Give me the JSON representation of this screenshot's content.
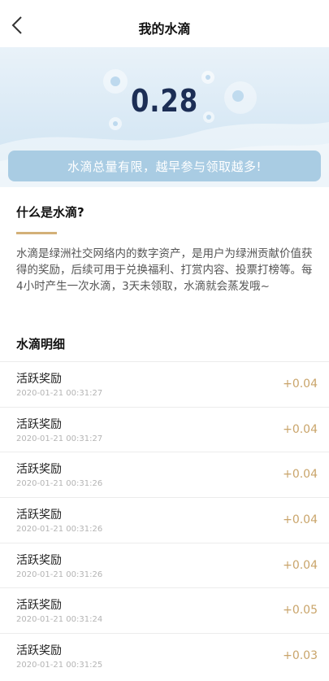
{
  "nav": {
    "title": "我的水滴"
  },
  "banner": {
    "balance": "0.28",
    "slogan": "水滴总量有限，越早参与领取越多!"
  },
  "about": {
    "title": "什么是水滴?",
    "description": "水滴是绿洲社交网络内的数字资产，是用户为绿洲贡献价值获得的奖励，后续可用于兑换福利、打赏内容、投票打榜等。每4小时产生一次水滴，3天未领取，水滴就会蒸发哦~"
  },
  "details": {
    "title": "水滴明细",
    "rows": [
      {
        "name": "活跃奖励",
        "time": "2020-01-21 00:31:27",
        "amount": "+0.04"
      },
      {
        "name": "活跃奖励",
        "time": "2020-01-21 00:31:27",
        "amount": "+0.04"
      },
      {
        "name": "活跃奖励",
        "time": "2020-01-21 00:31:26",
        "amount": "+0.04"
      },
      {
        "name": "活跃奖励",
        "time": "2020-01-21 00:31:26",
        "amount": "+0.04"
      },
      {
        "name": "活跃奖励",
        "time": "2020-01-21 00:31:26",
        "amount": "+0.04"
      },
      {
        "name": "活跃奖励",
        "time": "2020-01-21 00:31:24",
        "amount": "+0.05"
      },
      {
        "name": "活跃奖励",
        "time": "2020-01-21 00:31:25",
        "amount": "+0.03"
      }
    ]
  },
  "colors": {
    "accent_gold": "#c9a46a",
    "balance_navy": "#1c2e55",
    "slogan_bar": "#a9cce3"
  },
  "icons": {
    "back": "chevron-left-icon"
  }
}
